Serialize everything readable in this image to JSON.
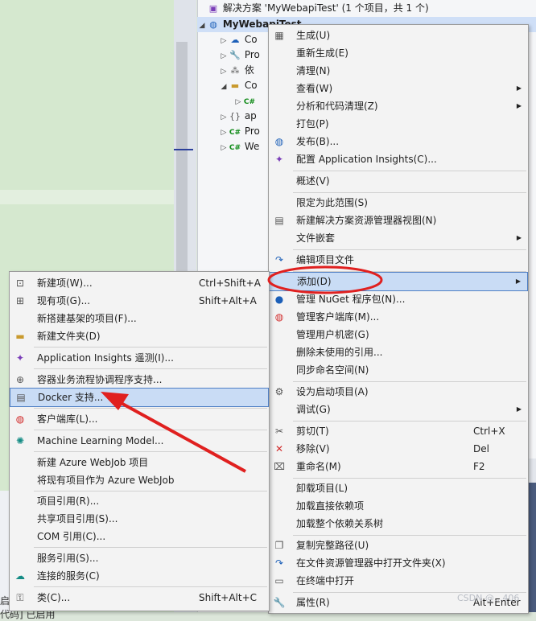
{
  "solution": {
    "title": "解决方案 'MyWebapiTest' (1 个项目，共 1 个)",
    "project": "MyWebapiTest",
    "nodes": [
      "Co",
      "Pro",
      "依",
      "Co",
      "",
      "ap",
      "Pro",
      "We"
    ]
  },
  "main_menu": {
    "items": [
      {
        "label": "生成(U)",
        "icon": "build-icon"
      },
      {
        "label": "重新生成(E)",
        "icon": ""
      },
      {
        "label": "清理(N)",
        "icon": ""
      },
      {
        "label": "查看(W)",
        "icon": "",
        "submenu": true
      },
      {
        "label": "分析和代码清理(Z)",
        "icon": "",
        "submenu": true
      },
      {
        "label": "打包(P)",
        "icon": ""
      },
      {
        "label": "发布(B)...",
        "icon": "globe-icon"
      },
      {
        "label": "配置 Application Insights(C)...",
        "icon": "insights-icon"
      },
      {
        "label": "概述(V)",
        "icon": ""
      },
      {
        "label": "限定为此范围(S)",
        "icon": ""
      },
      {
        "label": "新建解决方案资源管理器视图(N)",
        "icon": "new-view-icon"
      },
      {
        "label": "文件嵌套",
        "icon": "",
        "submenu": true
      },
      {
        "label": "编辑项目文件",
        "icon": "edit-icon"
      },
      {
        "label": "添加(D)",
        "icon": "",
        "submenu": true,
        "highlighted": true
      },
      {
        "label": "管理 NuGet 程序包(N)...",
        "icon": "nuget-icon"
      },
      {
        "label": "管理客户端库(M)...",
        "icon": "client-lib-icon"
      },
      {
        "label": "管理用户机密(G)",
        "icon": ""
      },
      {
        "label": "删除未使用的引用...",
        "icon": ""
      },
      {
        "label": "同步命名空间(N)",
        "icon": ""
      },
      {
        "label": "设为启动项目(A)",
        "icon": "gear-icon"
      },
      {
        "label": "调试(G)",
        "icon": "",
        "submenu": true
      },
      {
        "label": "剪切(T)",
        "icon": "scissors-icon",
        "shortcut": "Ctrl+X"
      },
      {
        "label": "移除(V)",
        "icon": "delete-icon",
        "shortcut": "Del"
      },
      {
        "label": "重命名(M)",
        "icon": "rename-icon",
        "shortcut": "F2"
      },
      {
        "label": "卸载项目(L)",
        "icon": ""
      },
      {
        "label": "加载直接依赖项",
        "icon": ""
      },
      {
        "label": "加载整个依赖关系树",
        "icon": ""
      },
      {
        "label": "复制完整路径(U)",
        "icon": "copy-icon"
      },
      {
        "label": "在文件资源管理器中打开文件夹(X)",
        "icon": "open-folder-icon"
      },
      {
        "label": "在终端中打开",
        "icon": "terminal-icon"
      },
      {
        "label": "属性(R)",
        "icon": "wrench-icon",
        "shortcut": "Alt+Enter"
      }
    ]
  },
  "sub_menu": {
    "items": [
      {
        "label": "新建项(W)...",
        "icon": "new-item-icon",
        "shortcut": "Ctrl+Shift+A"
      },
      {
        "label": "现有项(G)...",
        "icon": "existing-item-icon",
        "shortcut": "Shift+Alt+A"
      },
      {
        "label": "新搭建基架的项目(F)...",
        "icon": ""
      },
      {
        "label": "新建文件夹(D)",
        "icon": "new-folder-icon"
      },
      {
        "label": "Application Insights 遥测(I)...",
        "icon": "insights-icon"
      },
      {
        "label": "容器业务流程协调程序支持...",
        "icon": "container-icon"
      },
      {
        "label": "Docker 支持...",
        "icon": "docker-icon",
        "highlighted": true
      },
      {
        "label": "客户端库(L)...",
        "icon": "client-lib-icon"
      },
      {
        "label": "Machine Learning Model...",
        "icon": "ml-icon"
      },
      {
        "label": "新建 Azure WebJob 项目",
        "icon": ""
      },
      {
        "label": "将现有项目作为 Azure WebJob",
        "icon": ""
      },
      {
        "label": "项目引用(R)...",
        "icon": ""
      },
      {
        "label": "共享项目引用(S)...",
        "icon": ""
      },
      {
        "label": "COM 引用(C)...",
        "icon": ""
      },
      {
        "label": "服务引用(S)...",
        "icon": ""
      },
      {
        "label": "连接的服务(C)",
        "icon": "cloud-icon"
      },
      {
        "label": "类(C)...",
        "icon": "class-icon",
        "shortcut": "Shift+Alt+C"
      }
    ]
  },
  "background": {
    "bottom_text_1": "启",
    "bottom_text_2": "代码] 已启用"
  },
  "watermark": "CSDN @...406",
  "colors": {
    "highlight_fill": "#c9dcf5",
    "highlight_border": "#4f7fc4",
    "annotation_red": "#e0201f"
  }
}
